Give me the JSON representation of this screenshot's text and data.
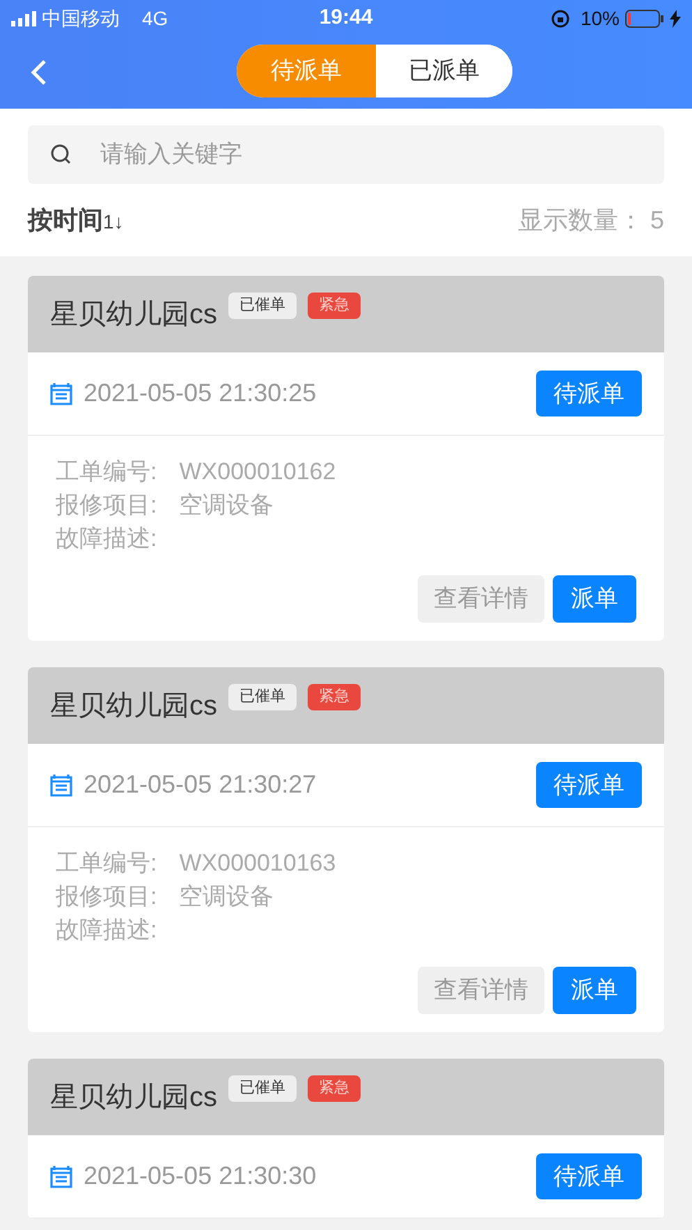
{
  "status_bar": {
    "carrier": "中国移动",
    "network": "4G",
    "time": "19:44",
    "battery": "10%"
  },
  "tabs": [
    {
      "label": "待派单",
      "selected": true
    },
    {
      "label": "已派单",
      "selected": false
    }
  ],
  "search": {
    "placeholder": "请输入关键字"
  },
  "sort": {
    "label": "按时间",
    "arrow": "1↓",
    "count_label": "显示数量：",
    "count": "5"
  },
  "orders": [
    {
      "title": "星贝幼儿园cs",
      "tags": [
        {
          "label": "已催单",
          "kind": "plain"
        },
        {
          "label": "紧急",
          "kind": "urgent"
        }
      ],
      "time": "2021-05-05 21:30:25",
      "status": "待派单",
      "fields": [
        {
          "label": "工单编号:",
          "value": "WX000010162"
        },
        {
          "label": "报修项目:",
          "value": "空调设备"
        },
        {
          "label": "故障描述:"
        }
      ],
      "actions": [
        {
          "label": "查看详情",
          "kind": "secondary"
        },
        {
          "label": "派单",
          "kind": "primary"
        }
      ]
    },
    {
      "title": "星贝幼儿园cs",
      "tags": [
        {
          "label": "已催单",
          "kind": "plain"
        },
        {
          "label": "紧急",
          "kind": "urgent"
        }
      ],
      "time": "2021-05-05 21:30:27",
      "status": "待派单",
      "fields": [
        {
          "label": "工单编号:",
          "value": "WX000010163"
        },
        {
          "label": "报修项目:",
          "value": "空调设备"
        },
        {
          "label": "故障描述:"
        }
      ],
      "actions": [
        {
          "label": "查看详情",
          "kind": "secondary"
        },
        {
          "label": "派单",
          "kind": "primary"
        }
      ]
    },
    {
      "title": "星贝幼儿园cs",
      "tags": [
        {
          "label": "已催单",
          "kind": "plain"
        },
        {
          "label": "紧急",
          "kind": "urgent"
        }
      ],
      "time": "2021-05-05 21:30:30",
      "status": "待派单"
    }
  ]
}
